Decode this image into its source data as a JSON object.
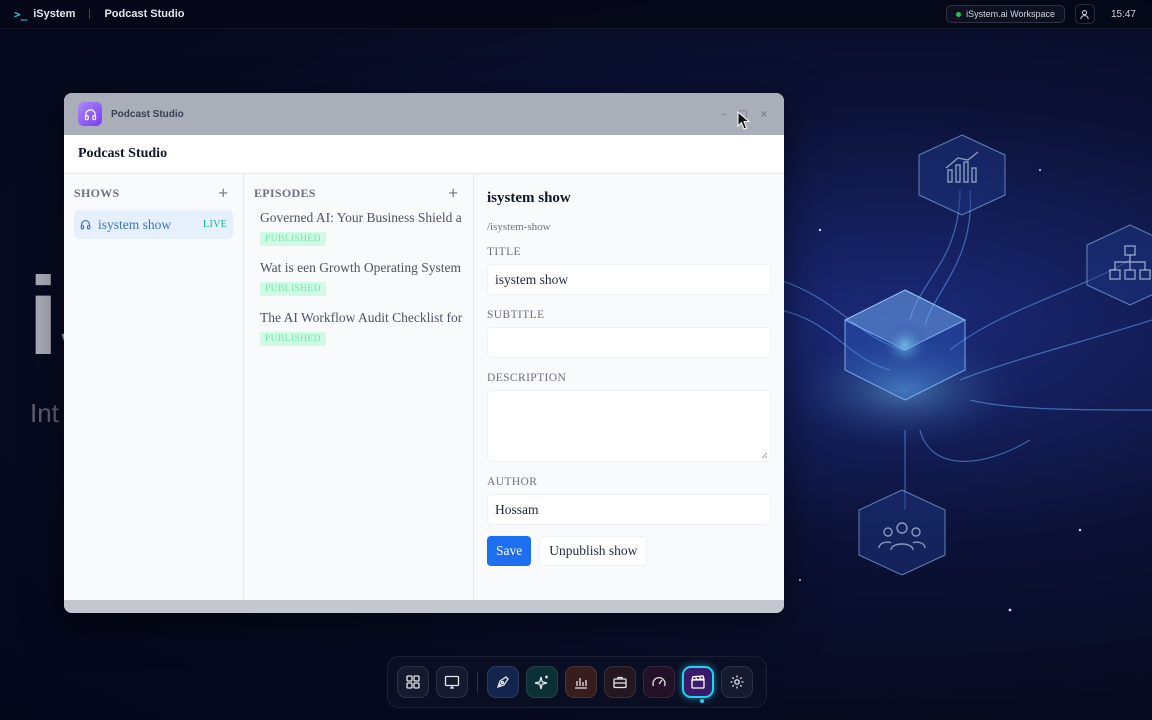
{
  "topbar": {
    "brand": "iSystem",
    "app_name": "Podcast Studio",
    "workspace": "iSystem.ai Workspace",
    "time": "15:47"
  },
  "background": {
    "big_text": "iS",
    "sub_text": "Int"
  },
  "window": {
    "title": "Podcast Studio",
    "header": "Podcast Studio",
    "controls": {
      "minimize": "–",
      "maximize": "□",
      "close": "×"
    }
  },
  "shows": {
    "header": "SHOWS",
    "add": "+",
    "items": [
      {
        "name": "isystem show",
        "status": "LIVE"
      }
    ]
  },
  "episodes": {
    "header": "EPISODES",
    "add": "+",
    "items": [
      {
        "title": "Governed AI: Your Business Shield a",
        "status": "PUBLISHED"
      },
      {
        "title": "Wat is een Growth Operating System",
        "status": "PUBLISHED"
      },
      {
        "title": "The AI Workflow Audit Checklist for",
        "status": "PUBLISHED"
      }
    ]
  },
  "detail": {
    "title": "isystem show",
    "slug": "/isystem-show",
    "fields": {
      "title_label": "TITLE",
      "title_value": "isystem show",
      "subtitle_label": "SUBTITLE",
      "subtitle_value": "",
      "description_label": "DESCRIPTION",
      "description_value": "",
      "author_label": "AUTHOR",
      "author_value": "Hossam"
    },
    "save_label": "Save",
    "unpublish_label": "Unpublish show"
  },
  "dock": {
    "items": [
      "apps-grid-icon",
      "monitor-icon",
      "pen-tool-icon",
      "sparkles-icon",
      "bar-chart-icon",
      "briefcase-icon",
      "gauge-icon",
      "clapperboard-icon",
      "gear-icon"
    ],
    "active": "clapperboard-icon"
  },
  "colors": {
    "accent": "#1d6ef0",
    "live": "#10b981",
    "published_bg": "#d1fae5",
    "active_dock": "#22d3ee"
  }
}
